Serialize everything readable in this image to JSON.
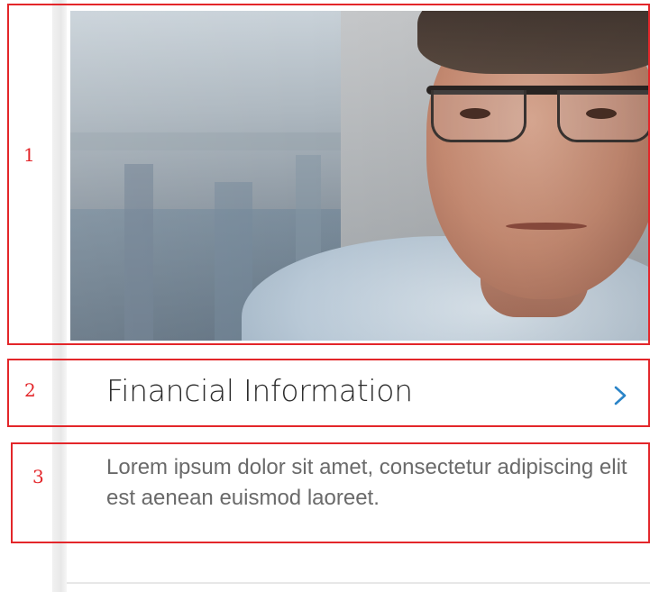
{
  "card": {
    "title": "Financial Information",
    "description": "Lorem ipsum dolor sit amet, consectetur adipiscing elit est aenean euismod laoreet.",
    "chevron_icon": "chevron-right-icon",
    "accent_color": "#2a84c8"
  },
  "annotations": [
    {
      "label": "1",
      "color": "#e3262a"
    },
    {
      "label": "2",
      "color": "#e3262a"
    },
    {
      "label": "3",
      "color": "#e3262a"
    }
  ]
}
